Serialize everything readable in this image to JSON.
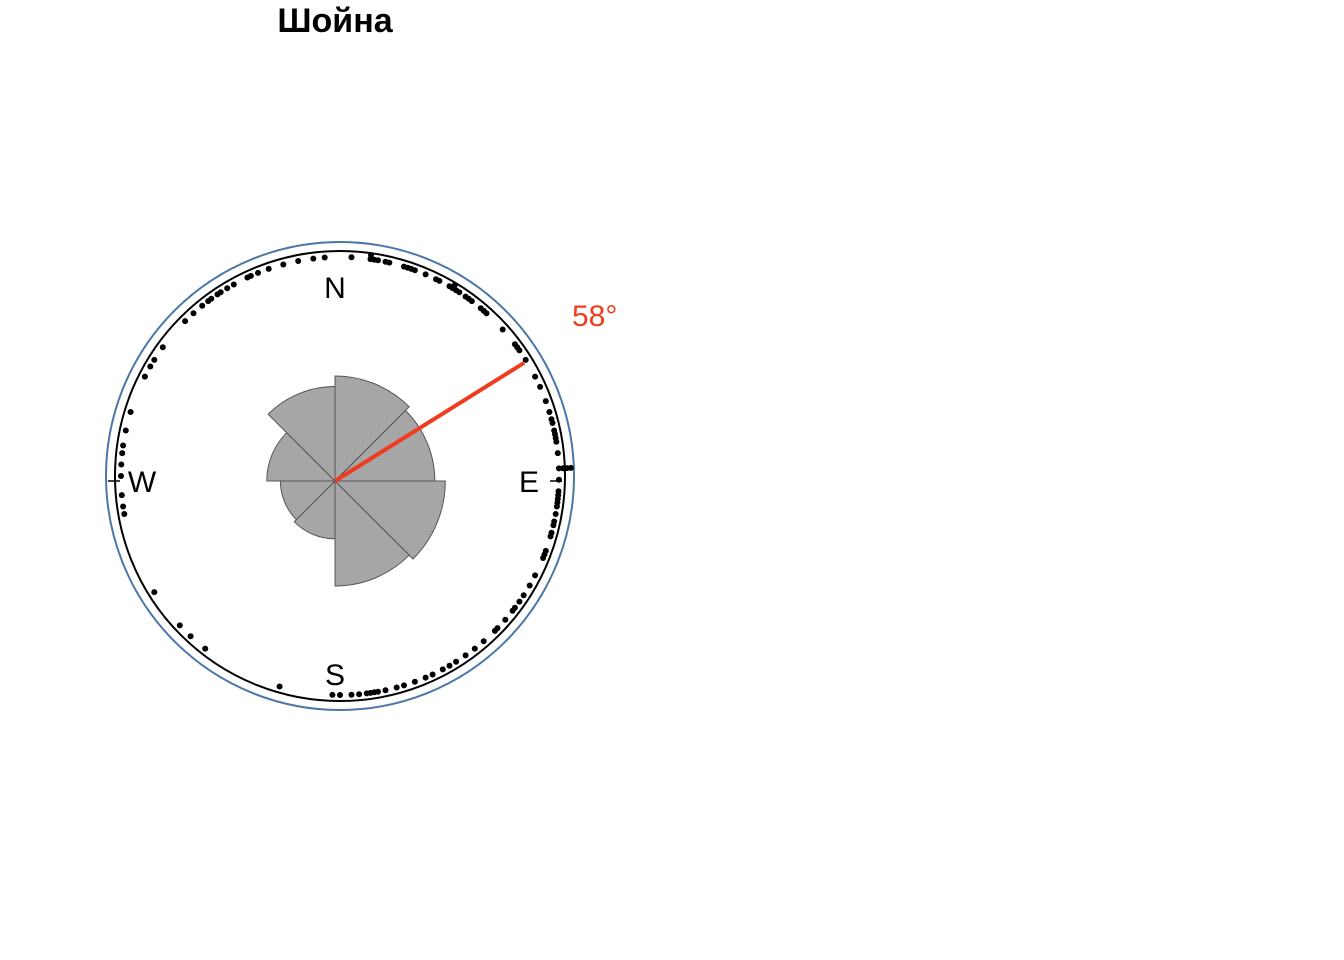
{
  "chart_data": {
    "type": "circular-rose",
    "title": "Шойна",
    "directions": [
      "N",
      "E",
      "S",
      "W"
    ],
    "mean_direction_deg": 58,
    "mean_label": "58°",
    "rose": {
      "bin_width_deg": 45,
      "bins": [
        {
          "start": 0,
          "end": 45,
          "radius": 1.0
        },
        {
          "start": 45,
          "end": 90,
          "radius": 0.95
        },
        {
          "start": 90,
          "end": 135,
          "radius": 1.05
        },
        {
          "start": 135,
          "end": 180,
          "radius": 1.0
        },
        {
          "start": 180,
          "end": 225,
          "radius": 0.55
        },
        {
          "start": 225,
          "end": 270,
          "radius": 0.52
        },
        {
          "start": 270,
          "end": 315,
          "radius": 0.65
        },
        {
          "start": 315,
          "end": 360,
          "radius": 0.9
        }
      ]
    },
    "observations_deg": [
      3,
      8,
      8,
      9,
      10,
      12,
      13,
      17,
      18,
      19,
      20,
      23,
      26,
      27,
      30,
      31,
      31,
      32,
      33,
      35,
      36,
      37,
      40,
      41,
      42,
      48,
      53,
      54,
      55,
      58,
      63,
      66,
      70,
      73,
      75,
      76,
      78,
      79,
      80,
      81,
      84,
      88,
      88,
      88,
      88,
      91,
      94,
      95,
      96,
      97,
      98,
      100,
      102,
      103,
      105,
      106,
      110,
      111,
      112,
      117,
      120,
      123,
      125,
      127,
      128,
      131,
      134,
      135,
      139,
      142,
      145,
      148,
      150,
      152,
      155,
      157,
      160,
      163,
      165,
      168,
      170,
      171,
      172,
      173,
      175,
      177,
      180,
      182,
      196,
      218,
      223,
      227,
      238,
      260,
      262,
      265,
      270,
      273,
      276,
      278,
      282,
      287,
      297,
      300,
      302,
      306,
      315,
      318,
      321,
      323,
      324,
      326,
      327,
      329,
      331,
      335,
      336,
      338,
      341,
      345,
      349,
      353,
      356
    ],
    "colors": {
      "outer_circle": "#4a77a8",
      "inner_circle": "#000000",
      "rose_fill": "#a6a6a6",
      "rose_stroke": "#555555",
      "mean_arrow": "#f03c1e",
      "points": "#000000"
    }
  }
}
